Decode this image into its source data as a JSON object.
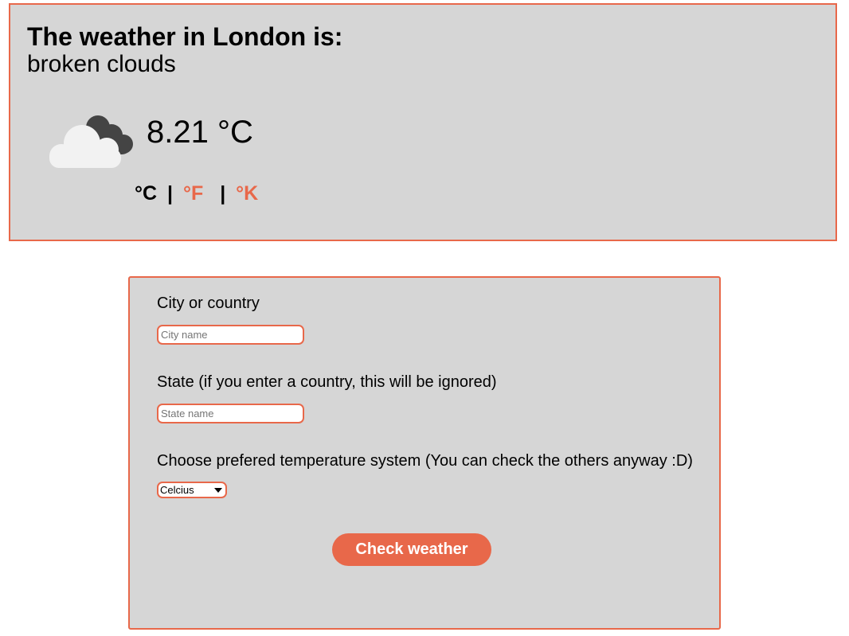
{
  "weather": {
    "title": "The weather in London is:",
    "description": "broken clouds",
    "icon": "broken-clouds-icon",
    "temperature": "8.21 °C",
    "units": {
      "celsius": "°C",
      "separator": "|",
      "fahrenheit": "°F",
      "kelvin": "°K"
    }
  },
  "form": {
    "city_label": "City or country",
    "city_placeholder": "City name",
    "city_value": "",
    "state_label": "State (if you enter a country, this will be ignored)",
    "state_placeholder": "State name",
    "state_value": "",
    "system_label": "Choose prefered temperature system (You can check the others anyway :D)",
    "system_selected": "Celcius",
    "submit_label": "Check weather"
  },
  "colors": {
    "accent": "#e8684a",
    "panel_bg": "#d6d6d6"
  }
}
